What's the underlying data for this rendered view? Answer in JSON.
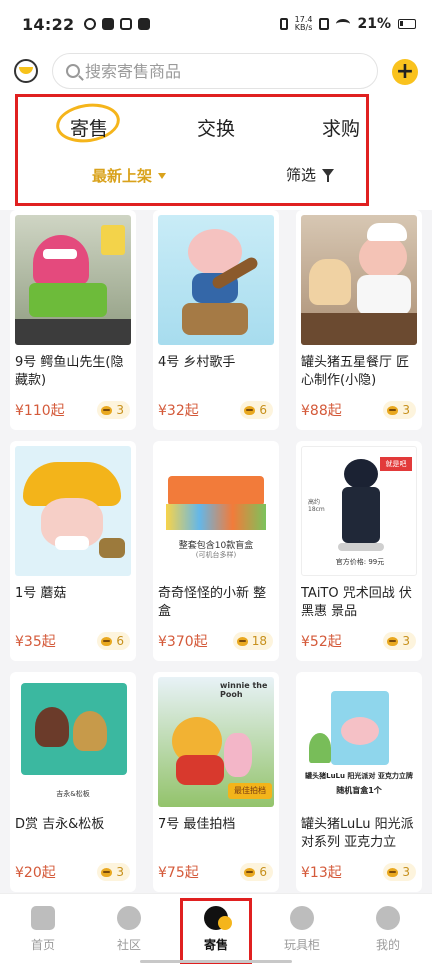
{
  "status_bar": {
    "time": "14:22",
    "net_speed_value": "17.4",
    "net_speed_unit": "KB/s",
    "battery": "21%"
  },
  "header": {
    "search_placeholder": "搜索寄售商品",
    "add_symbol": "+"
  },
  "tabs": [
    {
      "label": "寄售",
      "active": true
    },
    {
      "label": "交换",
      "active": false
    },
    {
      "label": "求购",
      "active": false
    }
  ],
  "sort": {
    "label": "最新上架"
  },
  "filter": {
    "label": "筛选"
  },
  "products": [
    {
      "title": "9号 鳄鱼山先生(隐藏款)",
      "price": "¥110起",
      "count": "3"
    },
    {
      "title": "4号 乡村歌手",
      "price": "¥32起",
      "count": "6"
    },
    {
      "title": "罐头猪五星餐厅 匠心制作(小隐)",
      "price": "¥88起",
      "count": "3"
    },
    {
      "title": "1号 蘑菇",
      "price": "¥35起",
      "count": "6"
    },
    {
      "title": "奇奇怪怪的小新 整盒",
      "price": "¥370起",
      "count": "18"
    },
    {
      "title": "TAiTO 咒术回战 伏黑惠 景品",
      "price": "¥52起",
      "count": "3"
    },
    {
      "title": "D赏 吉永&松板",
      "price": "¥20起",
      "count": "3"
    },
    {
      "title": "7号 最佳拍档",
      "price": "¥75起",
      "count": "6"
    },
    {
      "title": "罐头猪LuLu 阳光派对系列 亚克力立牌...",
      "price": "¥13起",
      "count": "3"
    }
  ],
  "image_text": {
    "box_caption": "整套包含10款盲盒",
    "box_caption_sub": "(可机台多样)",
    "figure_note": "官方价格: 99元",
    "figure_tag": "就是吧",
    "figure_height": "高约18cm",
    "pooh_logo": "winnie the Pooh",
    "pooh_badge": "最佳拍档",
    "card_caption": "吉永&松板",
    "lulu_caption": "罐头猪LuLu 阳光派对 亚克力立牌",
    "lulu_caption_sub": "随机盲盒1个"
  },
  "bottom_nav": [
    {
      "label": "首页",
      "icon": "home-52-icon"
    },
    {
      "label": "社区",
      "icon": "community-icon"
    },
    {
      "label": "寄售",
      "icon": "consign-icon",
      "active": true
    },
    {
      "label": "玩具柜",
      "icon": "toy-cabinet-icon"
    },
    {
      "label": "我的",
      "icon": "profile-icon"
    }
  ],
  "colors": {
    "accent": "#f5b51b",
    "price": "#d45a3a",
    "highlight_box": "#e02020"
  }
}
